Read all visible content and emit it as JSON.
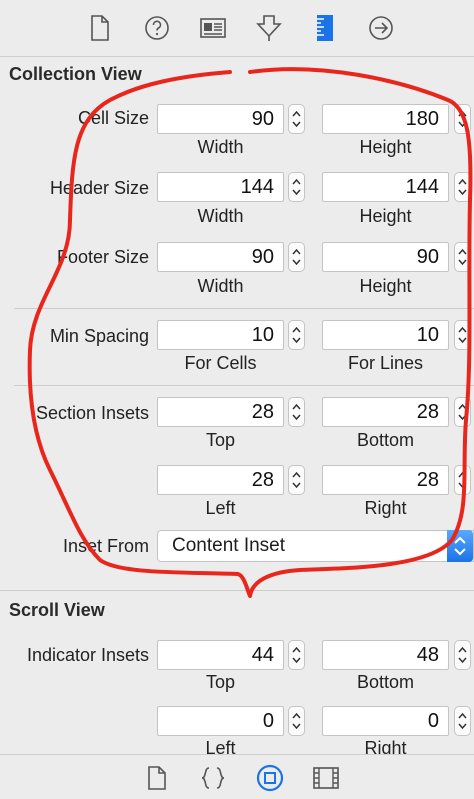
{
  "toolbar": {
    "icons": [
      "file-icon",
      "help-icon",
      "identity-icon",
      "attributes-icon",
      "size-icon",
      "connections-icon"
    ],
    "accent": "#1a74e8"
  },
  "collection_view": {
    "title": "Collection View",
    "cell_size": {
      "label": "Cell Size",
      "width": "90",
      "height": "180",
      "width_label": "Width",
      "height_label": "Height"
    },
    "header_size": {
      "label": "Header Size",
      "width": "144",
      "height": "144",
      "width_label": "Width",
      "height_label": "Height"
    },
    "footer_size": {
      "label": "Footer Size",
      "width": "90",
      "height": "90",
      "width_label": "Width",
      "height_label": "Height"
    },
    "min_spacing": {
      "label": "Min Spacing",
      "cells": "10",
      "lines": "10",
      "cells_label": "For Cells",
      "lines_label": "For Lines"
    },
    "section_insets": {
      "label": "Section Insets",
      "top": "28",
      "bottom": "28",
      "left": "28",
      "right": "28",
      "top_label": "Top",
      "bottom_label": "Bottom",
      "left_label": "Left",
      "right_label": "Right"
    },
    "inset_from": {
      "label": "Inset From",
      "value": "Content Inset"
    }
  },
  "scroll_view": {
    "title": "Scroll View",
    "indicator_insets": {
      "label": "Indicator Insets",
      "top": "44",
      "bottom": "48",
      "left": "0",
      "right": "0",
      "top_label": "Top",
      "bottom_label": "Bottom",
      "left_label": "Left",
      "right_label": "Right"
    }
  },
  "bottom_bar": {
    "icons": [
      "file-template-icon",
      "code-snippet-icon",
      "object-library-icon",
      "media-library-icon"
    ]
  },
  "colors": {
    "annotation": "#e8261b",
    "panel_bg": "#ececec"
  }
}
